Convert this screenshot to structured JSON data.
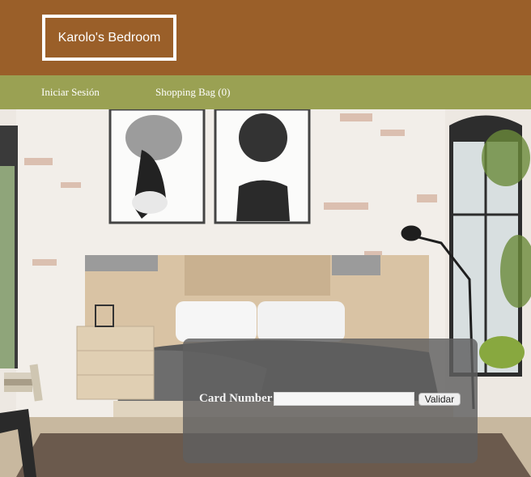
{
  "header": {
    "brand": "Karolo's Bedroom",
    "background_color": "#9a5f29"
  },
  "nav": {
    "background_color": "#9aa153",
    "login_label": "Iniciar Sesión",
    "shopping_bag_label": "Shopping Bag (0)"
  },
  "hero": {
    "scene": "bedroom-photo",
    "icons": [
      "portrait-art-icon",
      "floor-lamp-icon",
      "bed-icon",
      "nightstand-icon",
      "plant-icon"
    ]
  },
  "payment": {
    "card_label": "Card Number",
    "card_value": "",
    "card_placeholder": "",
    "validate_label": "Validar"
  }
}
